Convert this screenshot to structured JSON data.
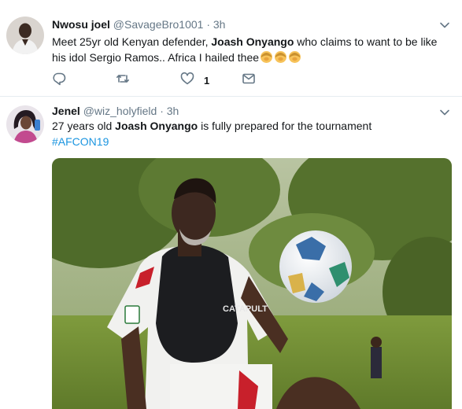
{
  "tweets": [
    {
      "name": "Nwosu joel",
      "handle": "@SavageBro1001",
      "dot": "·",
      "time": "3h",
      "text_1": "Meet 25yr old Kenyan defender,  ",
      "text_bold": "Joash Onyango",
      "text_2": " who claims to want to be like his idol Sergio Ramos.. Africa I hailed thee",
      "emoji": "person-bowing-emoji",
      "like_count": "1",
      "icons": [
        "reply-icon",
        "retweet-icon",
        "like-icon",
        "direct-message-icon"
      ]
    },
    {
      "name": "Jenel",
      "handle": "@wiz_holyfield",
      "dot": "·",
      "time": "3h",
      "text_1": "27 years old ",
      "text_bold": "Joash Onyango",
      "text_2": " is fully prepared for the tournament",
      "hashtag": "#AFCON19",
      "photo_text": "CATAPULT"
    }
  ],
  "colors": {
    "link": "#1b95e0",
    "secondary": "#657786",
    "primary": "#14171a",
    "divider": "#e6ecf0"
  }
}
